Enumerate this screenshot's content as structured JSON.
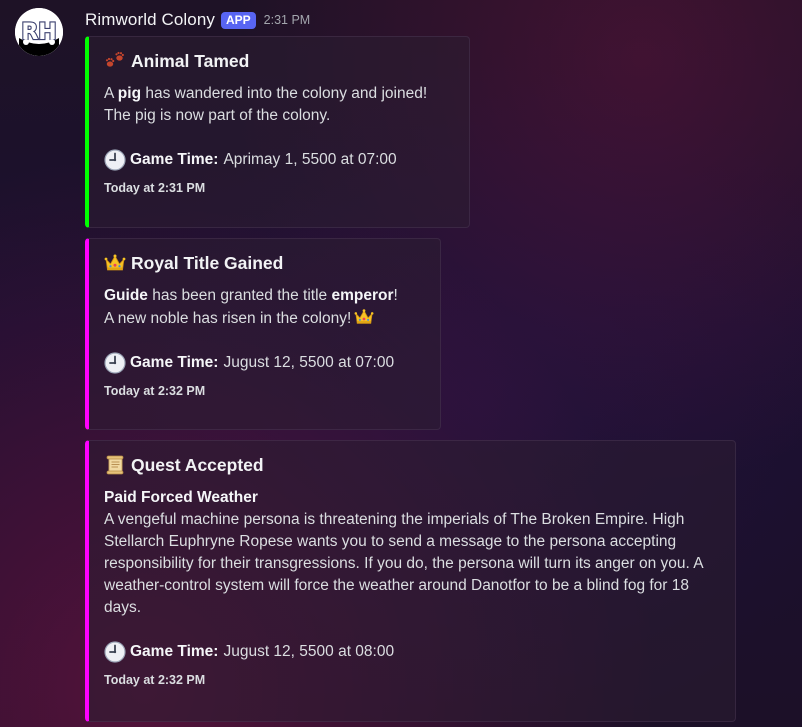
{
  "message": {
    "author": "Rimworld Colony",
    "badge": "APP",
    "time": "2:31 PM",
    "avatar_icon": "rimworld-rh-logo"
  },
  "embeds": [
    {
      "accent_color": "#00ff00",
      "title_icon": "paw-prints-icon",
      "title": "Animal Tamed",
      "description": {
        "prefix": "A ",
        "bold": "pig",
        "suffix": " has wandered into the colony and joined!",
        "line2": "The pig is now part of the colony."
      },
      "game_time_label": "Game Time:",
      "game_time_value": "Aprimay 1, 5500 at 07:00",
      "footer": "Today at 2:31 PM"
    },
    {
      "accent_color": "#ff00ff",
      "title_icon": "crown-icon",
      "title": "Royal Title Gained",
      "description": {
        "bold1": "Guide",
        "middle": " has been granted the title ",
        "bold2": "emperor",
        "end": "!",
        "line2": "A new noble has risen in the colony!"
      },
      "game_time_label": "Game Time:",
      "game_time_value": "Jugust 12, 5500 at 07:00",
      "footer": "Today at 2:32 PM"
    },
    {
      "accent_color": "#ff00ff",
      "title_icon": "scroll-icon",
      "title": "Quest Accepted",
      "description": {
        "heading": "Paid Forced Weather",
        "body": "A vengeful machine persona is threatening the imperials of The Broken Empire. High Stellarch Euphryne Ropese wants you to send a message to the persona accepting responsibility for their transgressions. If you do, the persona will turn its anger on you. A weather-control system will force the weather around Danotfor to be a blind fog for 18 days."
      },
      "game_time_label": "Game Time:",
      "game_time_value": "Jugust 12, 5500 at 08:00",
      "footer": "Today at 2:32 PM"
    }
  ]
}
